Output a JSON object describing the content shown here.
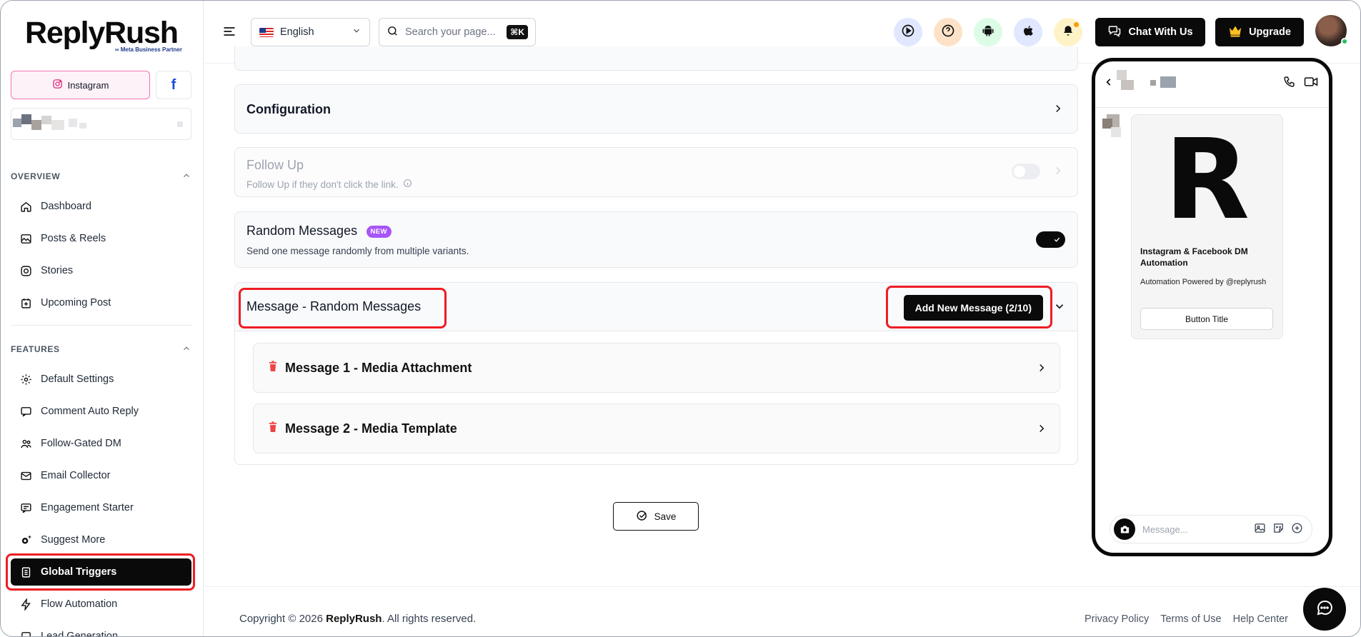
{
  "brand": {
    "logo_text": "ReplyRush",
    "partner_text": "∞ Meta Business Partner"
  },
  "sidebar": {
    "platforms": {
      "instagram_label": "Instagram",
      "facebook_label": "f"
    },
    "overview_label": "OVERVIEW",
    "features_label": "FEATURES",
    "overview_items": [
      {
        "label": "Dashboard",
        "icon": "home-icon"
      },
      {
        "label": "Posts & Reels",
        "icon": "image-icon"
      },
      {
        "label": "Stories",
        "icon": "instagram-icon"
      },
      {
        "label": "Upcoming Post",
        "icon": "calendar-plus-icon"
      }
    ],
    "feature_items": [
      {
        "label": "Default Settings",
        "icon": "gear-icon"
      },
      {
        "label": "Comment Auto Reply",
        "icon": "comment-icon"
      },
      {
        "label": "Follow-Gated DM",
        "icon": "users-icon"
      },
      {
        "label": "Email Collector",
        "icon": "mail-icon"
      },
      {
        "label": "Engagement Starter",
        "icon": "chat-list-icon"
      },
      {
        "label": "Suggest More",
        "icon": "sparkle-gear-icon"
      },
      {
        "label": "Global Triggers",
        "icon": "document-icon",
        "active": true
      },
      {
        "label": "Flow Automation",
        "icon": "lightning-icon"
      },
      {
        "label": "Lead Generation",
        "icon": "lead-icon"
      }
    ]
  },
  "header": {
    "language": "English",
    "search_placeholder": "Search your page...",
    "search_shortcut": "⌘K",
    "chat_label": "Chat With Us",
    "upgrade_label": "Upgrade"
  },
  "main": {
    "configuration_title": "Configuration",
    "follow_up_title": "Follow Up",
    "follow_up_desc": "Follow Up if they don't click the link.",
    "follow_up_enabled": false,
    "random_title": "Random Messages",
    "random_badge": "NEW",
    "random_desc": "Send one message randomly from multiple variants.",
    "random_enabled": true,
    "message_section_title": "Message - Random Messages",
    "add_message_label": "Add New Message (2/10)",
    "messages": [
      {
        "label": "Message 1 - Media Attachment"
      },
      {
        "label": "Message 2 - Media Template"
      }
    ],
    "save_label": "Save"
  },
  "preview": {
    "card_title": "Instagram & Facebook DM Automation",
    "card_subtitle": "Automation Powered by @replyrush",
    "button_title": "Button Title",
    "message_placeholder": "Message...",
    "logo_letter": "R"
  },
  "footer": {
    "copyright_prefix": "Copyright © 2026 ",
    "copyright_brand": "ReplyRush",
    "copyright_suffix": ". All rights reserved.",
    "links": [
      "Privacy Policy",
      "Terms of Use",
      "Help Center"
    ]
  },
  "colors": {
    "accent_dark": "#0a0a0a",
    "highlight_red": "#ef1c24",
    "new_badge": "#a855f7",
    "delete_red": "#ef4444",
    "online_green": "#22c55e"
  }
}
